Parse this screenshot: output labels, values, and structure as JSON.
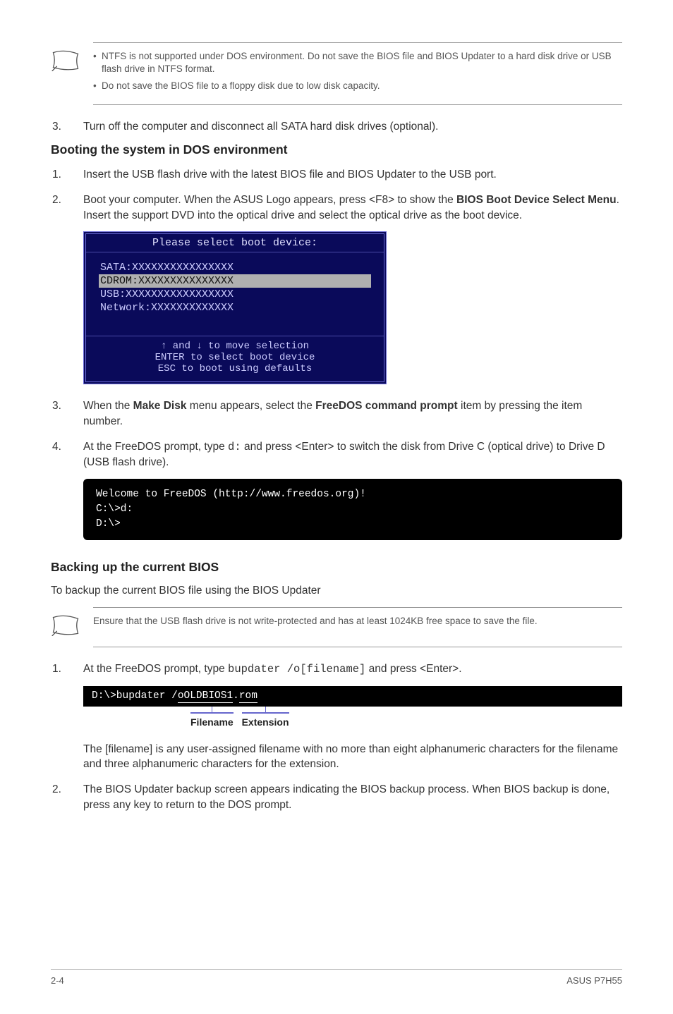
{
  "note1": {
    "bullets": [
      "NTFS is not supported under DOS environment. Do not save the BIOS file and BIOS Updater to a hard disk drive or USB flash drive in NTFS format.",
      "Do not save the BIOS file to a floppy disk due to low disk capacity."
    ]
  },
  "step3": {
    "num": "3.",
    "text": "Turn off the computer and disconnect all SATA hard disk drives (optional)."
  },
  "sectionA": {
    "title": "Booting the system in DOS environment"
  },
  "stepA1": {
    "num": "1.",
    "text": "Insert the USB flash drive with the latest BIOS file and BIOS Updater to the USB port."
  },
  "stepA2": {
    "num": "2.",
    "prefix": "Boot your computer. When the ASUS Logo appears, press <F8> to show the ",
    "bold1": "BIOS Boot Device Select Menu",
    "suffix": ". Insert the support DVD into the optical drive and select the optical drive as the boot device."
  },
  "bootbox": {
    "title": "Please select boot device:",
    "items": [
      "SATA:XXXXXXXXXXXXXXXX",
      "CDROM:XXXXXXXXXXXXXXX",
      "USB:XXXXXXXXXXXXXXXXX",
      "Network:XXXXXXXXXXXXX"
    ],
    "foot1": "↑ and ↓ to move selection",
    "foot2": "ENTER to select boot device",
    "foot3": "ESC to boot using defaults"
  },
  "stepA3": {
    "num": "3.",
    "p1": "When the ",
    "b1": "Make Disk",
    "p2": " menu appears, select the ",
    "b2": "FreeDOS command prompt",
    "p3": " item by pressing the item number."
  },
  "stepA4": {
    "num": "4.",
    "p1": "At the FreeDOS prompt, type ",
    "code": "d:",
    "p2": " and press <Enter> to switch the disk from Drive C (optical drive) to Drive D (USB flash drive)."
  },
  "term1": "Welcome to FreeDOS (http://www.freedos.org)!\nC:\\>d:\nD:\\>",
  "sectionB": {
    "title": "Backing up the current BIOS"
  },
  "subB": "To backup the current BIOS file using the BIOS Updater",
  "note2": {
    "text": "Ensure that the USB flash drive is not write-protected and has at least 1024KB free space to save the file."
  },
  "stepB1": {
    "num": "1.",
    "p1": "At the FreeDOS prompt, type ",
    "code": "bupdater /o[filename]",
    "p2": " and press <Enter>."
  },
  "term2": {
    "pre": "D:\\>bupdater /",
    "fn": "oOLDBIOS1",
    "dot": ".",
    "ext": "rom"
  },
  "annot": {
    "fn": "Filename",
    "ext": "Extension"
  },
  "stepB1b": "The [filename] is any user-assigned filename with no more than eight alphanumeric characters for the filename and three alphanumeric characters for the extension.",
  "stepB2": {
    "num": "2.",
    "text": "The BIOS Updater backup screen appears indicating the BIOS backup process. When BIOS backup is done, press any key to return to the DOS prompt."
  },
  "footer": {
    "left": "2-4",
    "right": "ASUS P7H55"
  }
}
